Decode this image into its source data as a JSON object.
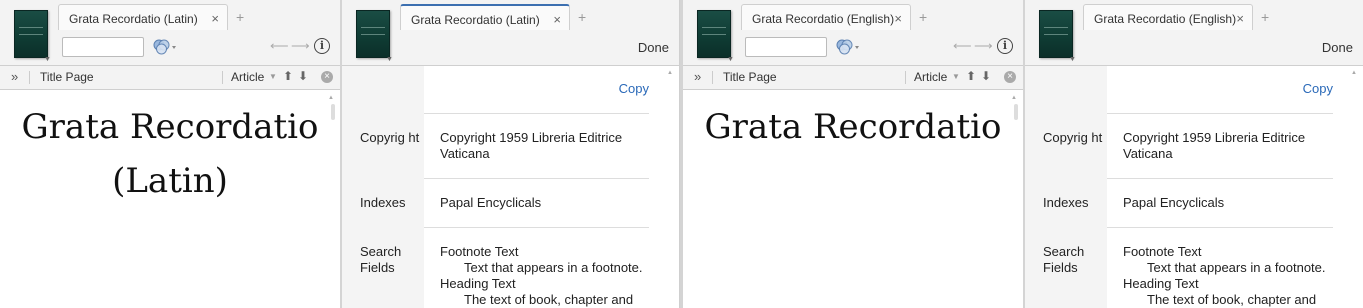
{
  "panels": [
    {
      "tab_label": "Grata Recordatio (Latin)",
      "toolbar": {
        "expand": "»",
        "title_page": "Title Page",
        "article": "Article"
      },
      "document_title_line1": "Grata Recordatio",
      "document_title_line2": "(Latin)"
    },
    {
      "tab_label": "Grata Recordatio (Latin)",
      "done_label": "Done",
      "copy_label": "Copy",
      "info": {
        "copyright_label": "Copyrig ht",
        "copyright_value": "Copyright 1959 Libreria Editrice Vaticana",
        "indexes_label": "Indexes",
        "indexes_value": "Papal Encyclicals",
        "search_fields_label": "Search Fields",
        "footnote_text": "Footnote Text",
        "footnote_desc": "Text that appears in a footnote.",
        "heading_text": "Heading Text",
        "heading_desc": "The text of book, chapter and"
      }
    },
    {
      "tab_label": "Grata Recordatio (English)",
      "toolbar": {
        "expand": "»",
        "title_page": "Title Page",
        "article": "Article"
      },
      "document_title_line1": "Grata Recordatio"
    },
    {
      "tab_label": "Grata Recordatio (English)",
      "done_label": "Done",
      "copy_label": "Copy",
      "info": {
        "copyright_label": "Copyrig ht",
        "copyright_value": "Copyright 1959 Libreria Editrice Vaticana",
        "indexes_label": "Indexes",
        "indexes_value": "Papal Encyclicals",
        "search_fields_label": "Search Fields",
        "footnote_text": "Footnote Text",
        "footnote_desc": "Text that appears in a footnote.",
        "heading_text": "Heading Text",
        "heading_desc": "The text of book, chapter and"
      }
    }
  ],
  "icons": {
    "close": "×",
    "add": "+",
    "back": "⟵",
    "forward": "⟶",
    "info": "i",
    "up": "⬆",
    "down": "⬇",
    "clear": "×"
  },
  "colors": {
    "accent": "#3c6fb0",
    "link": "#2a69b8",
    "book_cover": "#0f3b33"
  }
}
